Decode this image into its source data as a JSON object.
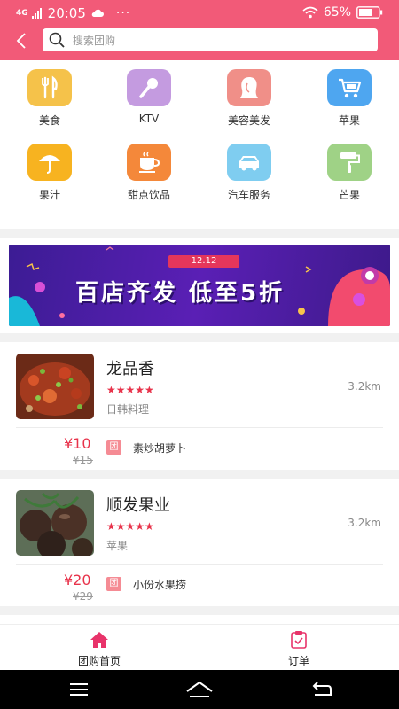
{
  "status_bar": {
    "network": "4G",
    "time": "20:05",
    "dots": "···",
    "battery_pct": "65%"
  },
  "search": {
    "placeholder": "搜索团购"
  },
  "categories": [
    {
      "label": "美食",
      "icon": "utensils-icon",
      "color": "#f5c24a"
    },
    {
      "label": "KTV",
      "icon": "microphone-icon",
      "color": "#c49be0"
    },
    {
      "label": "美容美发",
      "icon": "hair-salon-icon",
      "color": "#f08f88"
    },
    {
      "label": "苹果",
      "icon": "shopping-cart-icon",
      "color": "#4ea6f0"
    },
    {
      "label": "果汁",
      "icon": "umbrella-icon",
      "color": "#f7b320"
    },
    {
      "label": "甜点饮品",
      "icon": "coffee-cup-icon",
      "color": "#f4883a"
    },
    {
      "label": "汽车服务",
      "icon": "car-icon",
      "color": "#7fcdf0"
    },
    {
      "label": "芒果",
      "icon": "paint-roller-icon",
      "color": "#9fd286"
    }
  ],
  "banner": {
    "tag": "12.12",
    "headline": "百店齐发 低至5折"
  },
  "shops": [
    {
      "name": "龙品香",
      "stars": "★★★★★",
      "category": "日韩料理",
      "distance": "3.2km",
      "price": "¥10",
      "old_price": "¥15",
      "badge": "团",
      "deal": "素炒胡萝卜"
    },
    {
      "name": "顺发果业",
      "stars": "★★★★★",
      "category": "苹果",
      "distance": "3.2km",
      "price": "¥20",
      "old_price": "¥29",
      "badge": "团",
      "deal": "小份水果捞"
    }
  ],
  "tabbar": {
    "home": "团购首页",
    "orders": "订单",
    "active_color": "#e8336a"
  }
}
